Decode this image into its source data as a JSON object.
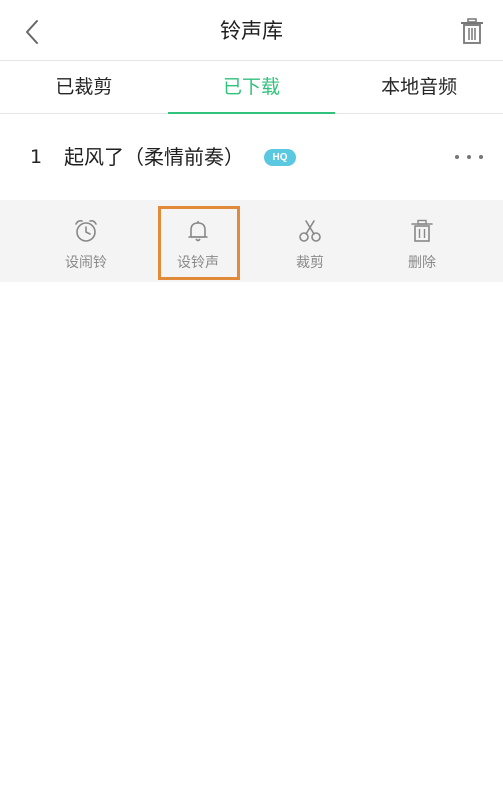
{
  "header": {
    "title": "铃声库",
    "back_icon": "chevron-left-icon",
    "trash_icon": "trash-icon"
  },
  "tabs": [
    {
      "label": "已裁剪",
      "active": false
    },
    {
      "label": "已下载",
      "active": true
    },
    {
      "label": "本地音频",
      "active": false
    }
  ],
  "song": {
    "index": "1",
    "title": "起风了（柔情前奏）",
    "badge": "HQ"
  },
  "actions": [
    {
      "label": "设闹铃",
      "icon": "alarm-clock-icon"
    },
    {
      "label": "设铃声",
      "icon": "bell-icon"
    },
    {
      "label": "裁剪",
      "icon": "scissors-icon"
    },
    {
      "label": "删除",
      "icon": "trash-icon"
    }
  ],
  "colors": {
    "accent": "#31c27c",
    "badge": "#5ac8e0",
    "highlight": "#e08a3a"
  }
}
